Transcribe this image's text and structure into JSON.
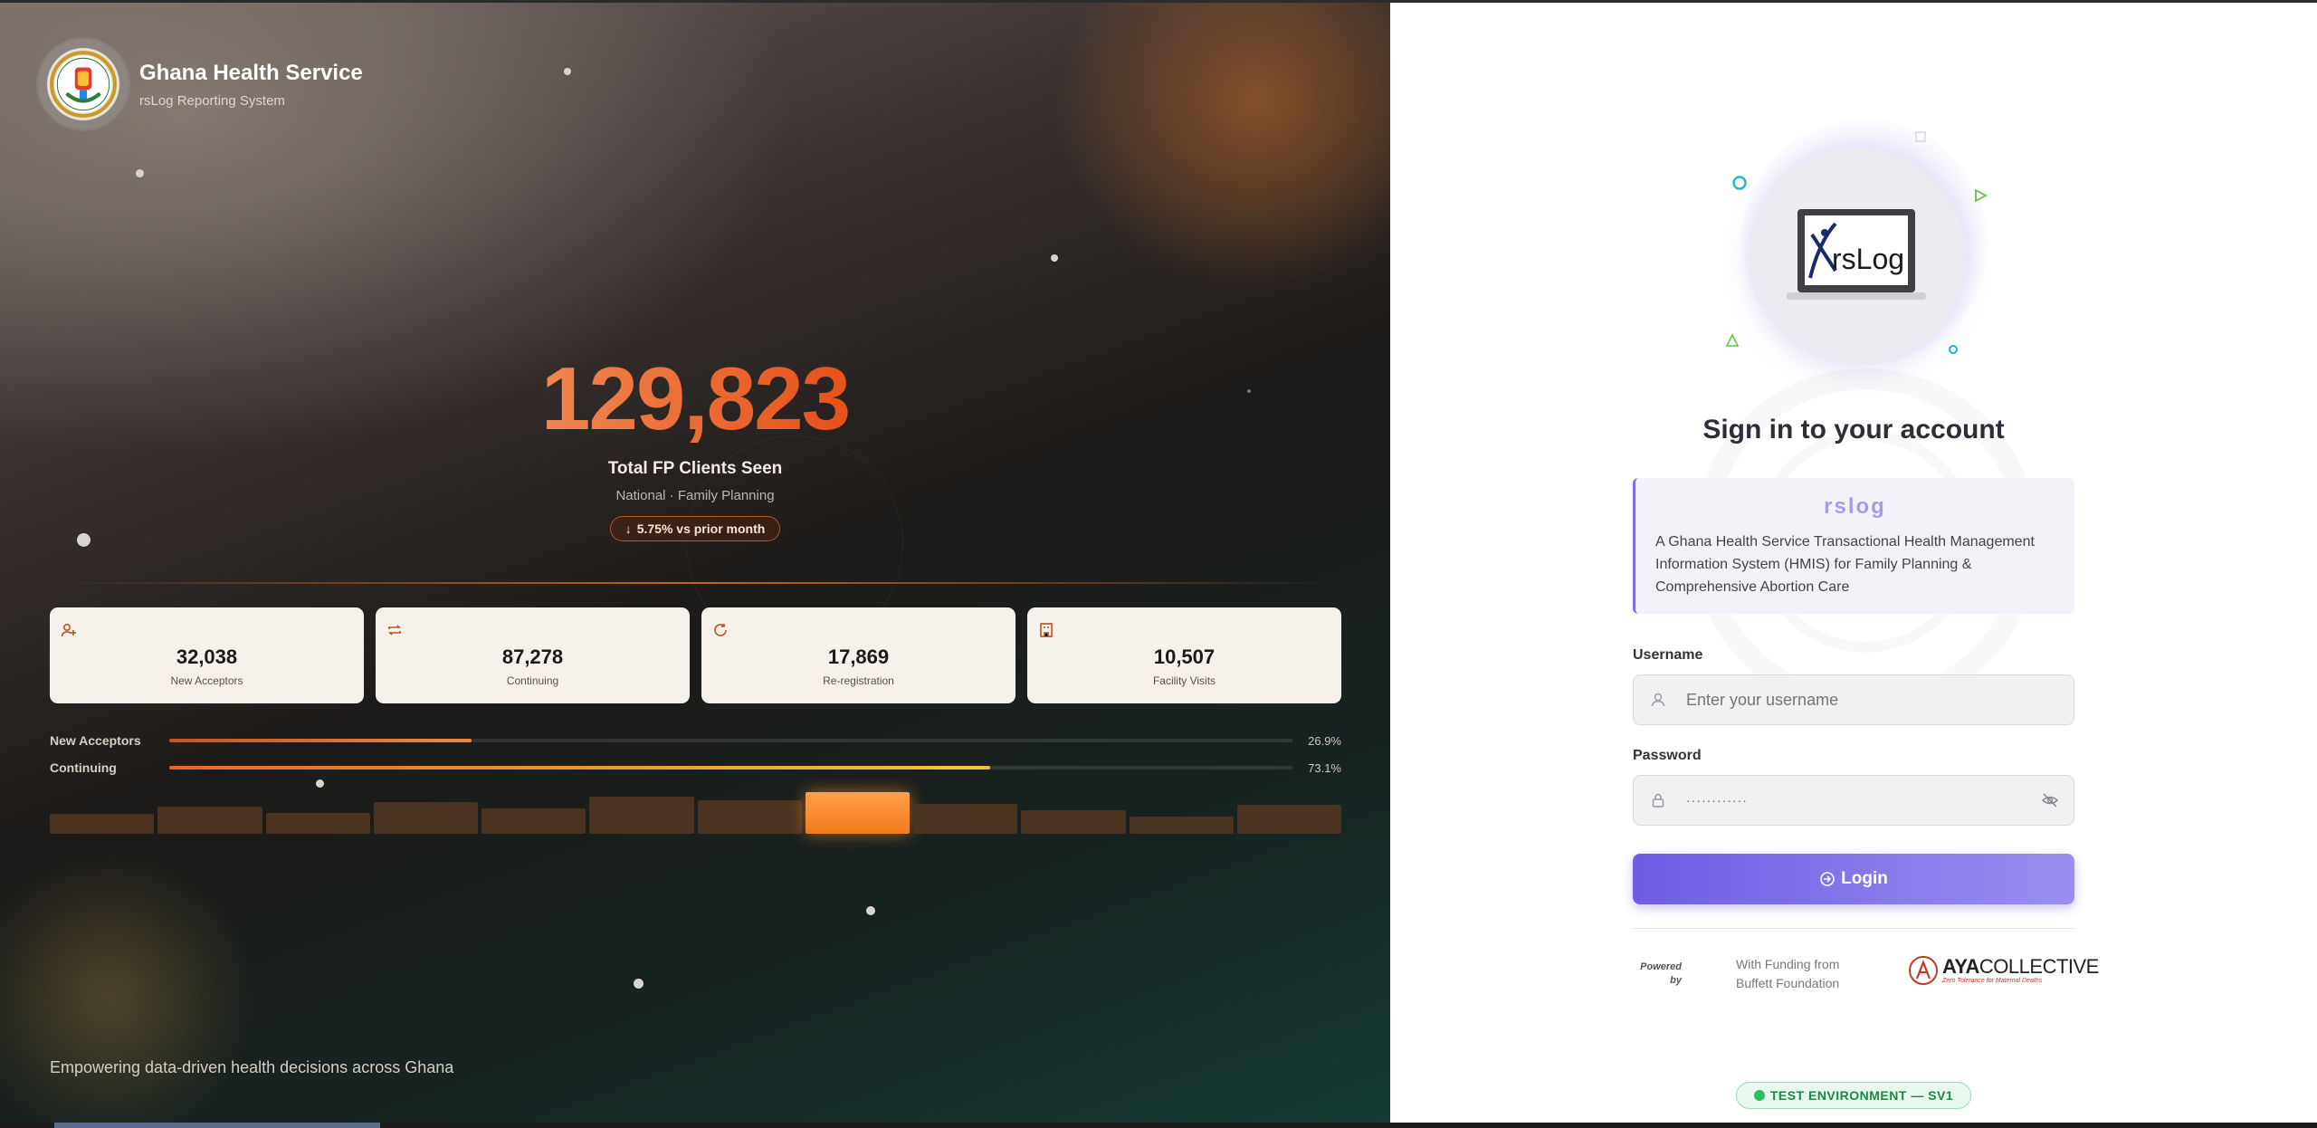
{
  "brand": {
    "title": "Ghana Health Service",
    "subtitle": "rsLog Reporting System"
  },
  "hero": {
    "number": "129,823",
    "label": "Total FP Clients Seen",
    "sublabel": "National · Family Planning",
    "badge_arrow": "↓",
    "badge_text": "5.75% vs prior month"
  },
  "stats": [
    {
      "icon": "user-plus-icon",
      "value": "32,038",
      "label": "New Acceptors"
    },
    {
      "icon": "repeat-icon",
      "value": "87,278",
      "label": "Continuing"
    },
    {
      "icon": "refresh-icon",
      "value": "17,869",
      "label": "Re-registration"
    },
    {
      "icon": "building-icon",
      "value": "10,507",
      "label": "Facility Visits"
    }
  ],
  "progress": [
    {
      "label": "New Acceptors",
      "percent": 26.9,
      "percent_text": "26.9%"
    },
    {
      "label": "Continuing",
      "percent": 73.1,
      "percent_text": "73.1%"
    }
  ],
  "mini_bars": {
    "values": [
      0.45,
      0.62,
      0.48,
      0.72,
      0.58,
      0.85,
      0.78,
      0.95,
      0.68,
      0.55,
      0.4,
      0.66
    ],
    "highlight_index": 7
  },
  "tagline": "Empowering data-driven health decisions across Ghana",
  "login": {
    "logo_text": "rsLog",
    "title": "Sign in to your account",
    "info_title": "rslog",
    "info_desc": "A Ghana Health Service Transactional Health Management Information System (HMIS) for Family Planning & Comprehensive Abortion Care",
    "username_label": "Username",
    "username_placeholder": "Enter your username",
    "password_label": "Password",
    "password_value": "············",
    "login_button": "Login"
  },
  "footer": {
    "powered_by": "Powered by",
    "funding_line1": "With Funding from",
    "funding_line2": "Buffett Foundation",
    "aya_name_bold": "AYA",
    "aya_name_thin": "COLLECTIVE",
    "aya_slogan": "Zero Tolerance for Maternal Deaths",
    "env_badge": "TEST ENVIRONMENT — SV1"
  },
  "colors": {
    "accent": "#6e5de4",
    "hero_orange": "#e6541c",
    "env_green": "#188a43"
  }
}
